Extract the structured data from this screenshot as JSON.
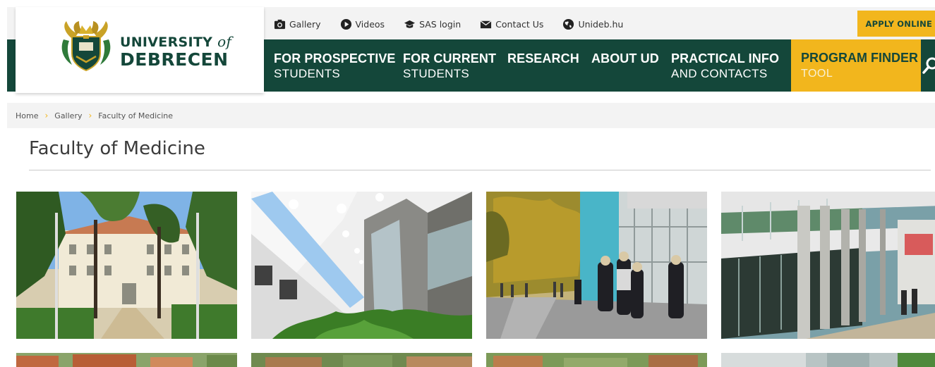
{
  "header": {
    "logo": {
      "line1": "UNIVERSITY",
      "line1_of": "of",
      "line2": "DEBRECEN",
      "crest_icon": "university-crest"
    },
    "utility_links": [
      {
        "label": "Gallery",
        "icon": "camera-icon"
      },
      {
        "label": "Videos",
        "icon": "play-icon"
      },
      {
        "label": "SAS login",
        "icon": "graduation-cap-icon"
      },
      {
        "label": "Contact Us",
        "icon": "envelope-icon"
      },
      {
        "label": "Unideb.hu",
        "icon": "globe-icon"
      }
    ],
    "apply_label": "APPLY ONLINE",
    "nav": [
      {
        "line1": "FOR PROSPECTIVE",
        "line2": "STUDENTS"
      },
      {
        "line1": "FOR CURRENT",
        "line2": "STUDENTS"
      },
      {
        "line1": "RESEARCH",
        "line2": ""
      },
      {
        "line1": "ABOUT UD",
        "line2": ""
      },
      {
        "line1": "PRACTICAL INFO",
        "line2": "AND CONTACTS"
      }
    ],
    "program_finder": {
      "line1": "PROGRAM FINDER",
      "line2": "TOOL"
    },
    "search_icon": "search-icon"
  },
  "breadcrumb": {
    "items": [
      "Home",
      "Gallery",
      "Faculty of Medicine"
    ],
    "separator": "›"
  },
  "page": {
    "title": "Faculty of Medicine"
  },
  "gallery": {
    "photos": [
      "campus-building-with-trees-photo",
      "atrium-interior-photo",
      "students-outside-glass-building-photo",
      "glass-facade-with-columns-photo",
      "aerial-rooftops-photo",
      "aerial-campus-photo",
      "aerial-green-campus-photo",
      "glass-building-corner-photo"
    ]
  },
  "colors": {
    "brand_green": "#14473a",
    "accent_yellow": "#f2b61d",
    "topbar_gray": "#f3f3f3"
  }
}
